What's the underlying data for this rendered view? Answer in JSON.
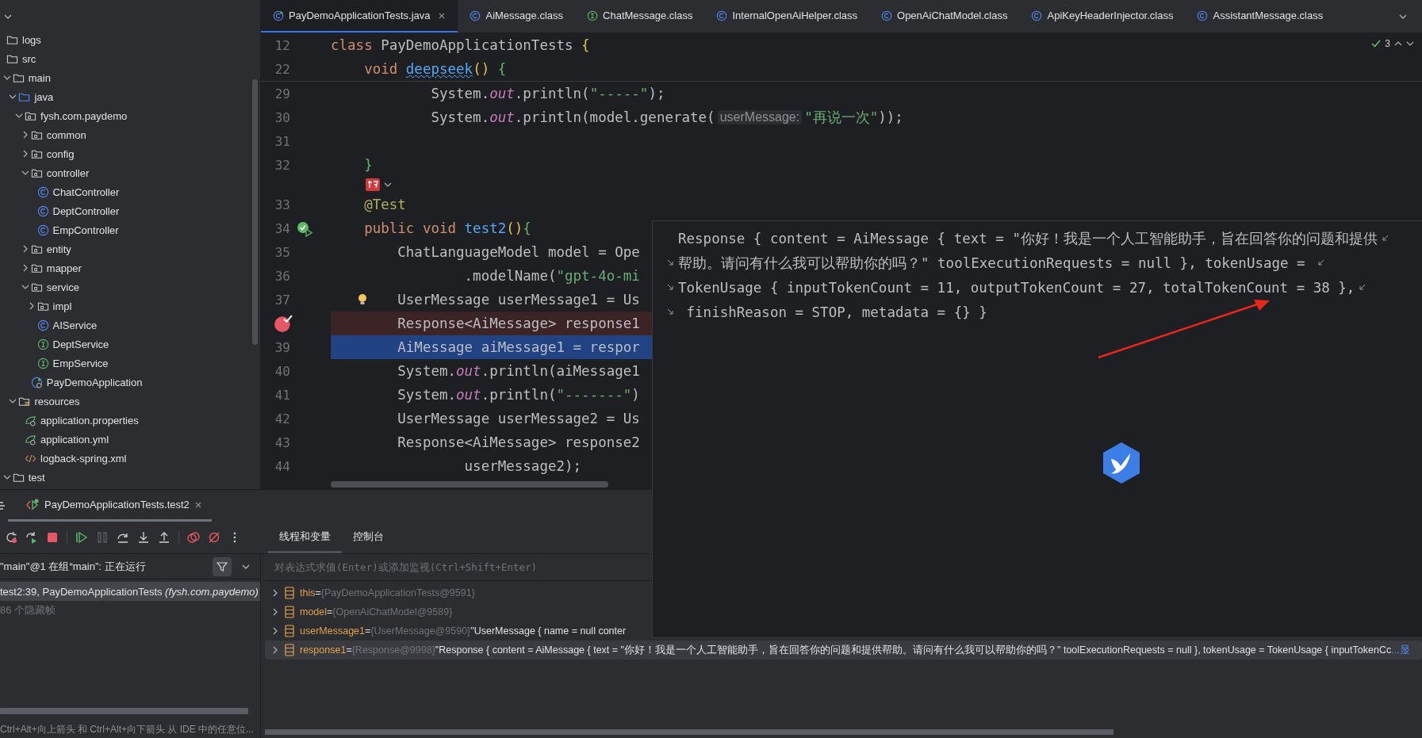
{
  "project_tree": {
    "items": [
      {
        "label": "logs",
        "kind": "folder"
      },
      {
        "label": "src",
        "kind": "folder",
        "children": [
          {
            "label": "main",
            "kind": "folder",
            "expanded": true,
            "children": [
              {
                "label": "java",
                "kind": "source-root",
                "expanded": true,
                "children": [
                  {
                    "label": "fysh.com.paydemo",
                    "kind": "package",
                    "expanded": true,
                    "children": [
                      {
                        "label": "common",
                        "kind": "package",
                        "expanded": false
                      },
                      {
                        "label": "config",
                        "kind": "package",
                        "expanded": false
                      },
                      {
                        "label": "controller",
                        "kind": "package",
                        "expanded": true,
                        "children": [
                          {
                            "label": "ChatController",
                            "kind": "class"
                          },
                          {
                            "label": "DeptController",
                            "kind": "class"
                          },
                          {
                            "label": "EmpController",
                            "kind": "class"
                          }
                        ]
                      },
                      {
                        "label": "entity",
                        "kind": "package",
                        "expanded": false
                      },
                      {
                        "label": "mapper",
                        "kind": "package",
                        "expanded": false
                      },
                      {
                        "label": "service",
                        "kind": "package",
                        "expanded": true,
                        "children": [
                          {
                            "label": "impl",
                            "kind": "package",
                            "expanded": false
                          },
                          {
                            "label": "AIService",
                            "kind": "class"
                          },
                          {
                            "label": "DeptService",
                            "kind": "interface"
                          },
                          {
                            "label": "EmpService",
                            "kind": "interface"
                          }
                        ]
                      },
                      {
                        "label": "PayDemoApplication",
                        "kind": "app"
                      }
                    ]
                  }
                ]
              },
              {
                "label": "resources",
                "kind": "resources",
                "expanded": true,
                "children": [
                  {
                    "label": "application.properties",
                    "kind": "spring-config"
                  },
                  {
                    "label": "application.yml",
                    "kind": "spring-config"
                  },
                  {
                    "label": "logback-spring.xml",
                    "kind": "xml"
                  }
                ]
              }
            ]
          },
          {
            "label": "test",
            "kind": "folder",
            "expanded": true
          }
        ]
      }
    ]
  },
  "editor_tabs": [
    {
      "label": "PayDemoApplicationTests.java",
      "kind": "test",
      "selected": true,
      "closable": true
    },
    {
      "label": "AiMessage.class",
      "kind": "class",
      "selected": false,
      "closable": false
    },
    {
      "label": "ChatMessage.class",
      "kind": "interface",
      "selected": false,
      "closable": false
    },
    {
      "label": "InternalOpenAiHelper.class",
      "kind": "class",
      "selected": false,
      "closable": false
    },
    {
      "label": "OpenAiChatModel.class",
      "kind": "class",
      "selected": false,
      "closable": false
    },
    {
      "label": "ApiKeyHeaderInjector.class",
      "kind": "class",
      "selected": false,
      "closable": false
    },
    {
      "label": "AssistantMessage.class",
      "kind": "class",
      "selected": false,
      "closable": false
    }
  ],
  "editor": {
    "inspection_count": "3",
    "sticky_lines": [
      {
        "number": "12",
        "tokens": [
          {
            "kind": "kw",
            "text": "class "
          },
          {
            "kind": "plain",
            "text": "PayDemoApplicationTests "
          },
          {
            "kind": "b1",
            "text": "{"
          }
        ]
      },
      {
        "number": "22",
        "tokens": [
          {
            "kind": "kw",
            "text": "    void "
          },
          {
            "kind": "fnwarn",
            "text": "deepseek"
          },
          {
            "kind": "b1",
            "text": "()"
          },
          {
            "kind": "b2",
            "text": " {"
          }
        ]
      }
    ],
    "lines": [
      {
        "kind": "normal",
        "number": "29",
        "tokens": [
          {
            "kind": "plain",
            "text": "            System."
          },
          {
            "kind": "field",
            "text": "out"
          },
          {
            "kind": "plain",
            "text": ".println("
          },
          {
            "kind": "str",
            "text": "\"-----\""
          },
          {
            "kind": "plain",
            "text": ");"
          }
        ]
      },
      {
        "kind": "normal",
        "number": "30",
        "tokens": [
          {
            "kind": "plain",
            "text": "            System."
          },
          {
            "kind": "field",
            "text": "out"
          },
          {
            "kind": "plain",
            "text": ".println(model.generate("
          },
          {
            "kind": "hint",
            "text": "userMessage:"
          },
          {
            "kind": "str",
            "text": "\"再说一次\""
          },
          {
            "kind": "plain",
            "text": "));"
          }
        ]
      },
      {
        "kind": "normal",
        "number": "31"
      },
      {
        "kind": "normal",
        "number": "32",
        "tokens": [
          {
            "kind": "b2",
            "text": "    }"
          }
        ]
      },
      {
        "kind": "plugin"
      },
      {
        "kind": "normal",
        "number": "33",
        "tokens": [
          {
            "kind": "ann",
            "text": "    @Test"
          }
        ]
      },
      {
        "kind": "normal",
        "number": "34",
        "gutter": {
          "kind": "run-passed"
        },
        "tokens": [
          {
            "kind": "kw",
            "text": "    public void "
          },
          {
            "kind": "fn",
            "text": "test2"
          },
          {
            "kind": "b1",
            "text": "()"
          },
          {
            "kind": "b2",
            "text": "{"
          }
        ]
      },
      {
        "kind": "normal",
        "number": "35",
        "tokens": [
          {
            "kind": "plain",
            "text": "        ChatLanguageModel model = Ope"
          }
        ]
      },
      {
        "kind": "normal",
        "number": "36",
        "tokens": [
          {
            "kind": "plain",
            "text": "                .modelName("
          },
          {
            "kind": "str",
            "text": "\"gpt-4o-mi"
          }
        ]
      },
      {
        "kind": "normal",
        "number": "37",
        "gutter": {
          "kind": "bulb"
        },
        "tokens": [
          {
            "kind": "plain",
            "text": "        UserMessage userMessage1 = Us"
          }
        ]
      },
      {
        "kind": "breakpoint",
        "tokens": [
          {
            "kind": "plain",
            "text": "        Response<AiMessage> response1"
          }
        ]
      },
      {
        "kind": "current",
        "number": "39",
        "tokens": [
          {
            "kind": "plain",
            "text": "        AiMessage aiMessage1 = respor"
          }
        ]
      },
      {
        "kind": "normal",
        "number": "40",
        "tokens": [
          {
            "kind": "plain",
            "text": "        System."
          },
          {
            "kind": "field",
            "text": "out"
          },
          {
            "kind": "plain",
            "text": ".println(aiMessage1"
          }
        ]
      },
      {
        "kind": "normal",
        "number": "41",
        "tokens": [
          {
            "kind": "plain",
            "text": "        System."
          },
          {
            "kind": "field",
            "text": "out"
          },
          {
            "kind": "plain",
            "text": ".println("
          },
          {
            "kind": "str",
            "text": "\"-------\""
          },
          {
            "kind": "plain",
            "text": ")"
          }
        ]
      },
      {
        "kind": "normal",
        "number": "42",
        "tokens": [
          {
            "kind": "plain",
            "text": "        UserMessage userMessage2 = Us"
          }
        ]
      },
      {
        "kind": "normal",
        "number": "43",
        "tokens": [
          {
            "kind": "plain",
            "text": "        Response<AiMessage> response2"
          }
        ]
      },
      {
        "kind": "normal",
        "number": "44",
        "tokens": [
          {
            "kind": "plain",
            "text": "                userMessage2);"
          }
        ]
      }
    ]
  },
  "value_popup": {
    "lines": [
      {
        "text": "Response { content = AiMessage { text = \"你好！我是一个人工智能助手，旨在回答你的问题和提供",
        "continued": false,
        "wraps": true
      },
      {
        "text": "帮助。请问有什么我可以帮助你的吗？\" toolExecutionRequests = null }, tokenUsage = ",
        "continued": true,
        "wraps": true
      },
      {
        "text": "TokenUsage { inputTokenCount = 11, outputTokenCount = 27, totalTokenCount = 38 },",
        "continued": true,
        "wraps": true
      },
      {
        "text": " finishReason = STOP, metadata = {} }",
        "continued": true,
        "wraps": false
      }
    ]
  },
  "debug": {
    "session_tab": {
      "label": "PayDemoApplicationTests.test2",
      "selected": true
    },
    "tool_tabs": [
      {
        "label": "线程和变量",
        "selected": true
      },
      {
        "label": "控制台",
        "selected": false
      }
    ],
    "thread": "\"main\"@1 在组“main”: 正在运行",
    "frames": [
      {
        "text": "test2:39, PayDemoApplicationTests",
        "package": "(fysh.com.paydemo)",
        "selected": true
      }
    ],
    "hidden_frames": "86 个隐藏帧",
    "evaluate_placeholder": "对表达式求值(Enter)或添加监视(Ctrl+Shift+Enter)",
    "variables": [
      {
        "name": "this",
        "sign": "=",
        "type": "{PayDemoApplicationTests@9591}",
        "selected": false
      },
      {
        "name": "model",
        "sign": "=",
        "type": "{OpenAiChatModel@9589}",
        "selected": false
      },
      {
        "name": "userMessage1",
        "sign": "=",
        "type": "{UserMessage@9590}",
        "value": "\"UserMessage { name = null conter",
        "selected": false
      },
      {
        "name": "response1",
        "sign": "=",
        "type": "{Response@9998}",
        "value": "\"Response { content = AiMessage { text = \"你好！我是一个人工智能助手，旨在回答你的问题和提供帮助。请问有什么我可以帮助你的吗？\" toolExecutionRequests = null }, tokenUsage = TokenUsage { inputTokenCc",
        "more": "...显",
        "selected": true
      }
    ],
    "hint": "Ctrl+Alt+向上箭头 和 Ctrl+Alt+向下箭头 从 IDE 中的任意位..."
  }
}
